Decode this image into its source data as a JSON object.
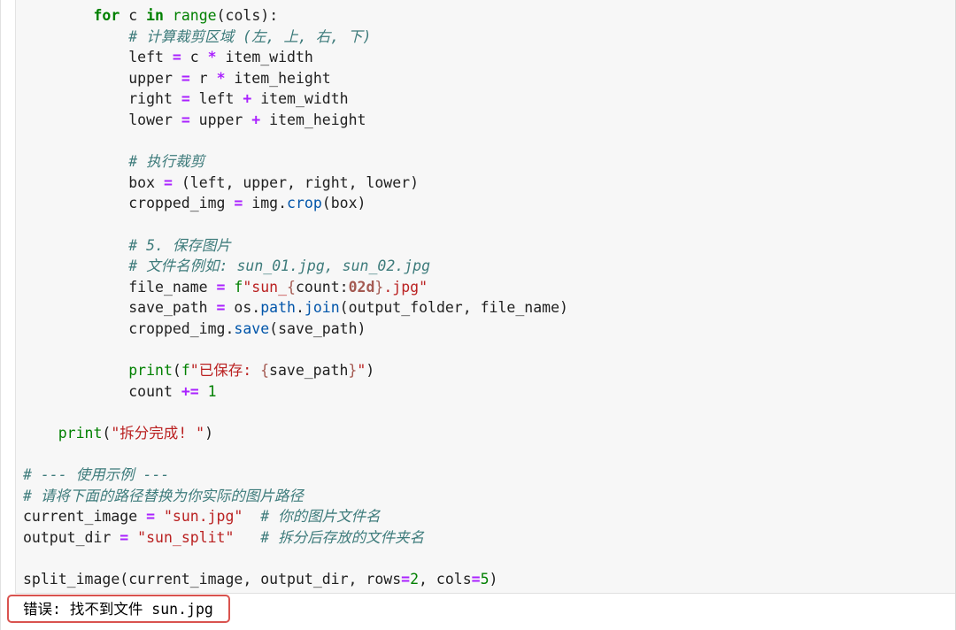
{
  "code_lines": [
    "        for c in range(cols):",
    "            # 计算裁剪区域 (左, 上, 右, 下)",
    "            left = c * item_width",
    "            upper = r * item_height",
    "            right = left + item_width",
    "            lower = upper + item_height",
    "",
    "            # 执行裁剪",
    "            box = (left, upper, right, lower)",
    "            cropped_img = img.crop(box)",
    "",
    "            # 5. 保存图片",
    "            # 文件名例如: sun_01.jpg, sun_02.jpg",
    "            file_name = f\"sun_{count:02d}.jpg\"",
    "            save_path = os.path.join(output_folder, file_name)",
    "            cropped_img.save(save_path)",
    "",
    "            print(f\"已保存: {save_path}\")",
    "            count += 1",
    "",
    "    print(\"拆分完成! \")",
    "",
    "# --- 使用示例 ---",
    "# 请将下面的路径替换为你实际的图片路径",
    "current_image = \"sun.jpg\"  # 你的图片文件名",
    "output_dir = \"sun_split\"   # 拆分后存放的文件夹名",
    "",
    "split_image(current_image, output_dir, rows=2, cols=5)"
  ],
  "output": {
    "error_text": "错误: 找不到文件 sun.jpg"
  },
  "colors": {
    "keyword": "#008000",
    "operator": "#aa22ff",
    "string": "#ba2121",
    "comment": "#3d7b7b",
    "error_border": "#d9534f",
    "cell_background": "#f7f7f7"
  }
}
